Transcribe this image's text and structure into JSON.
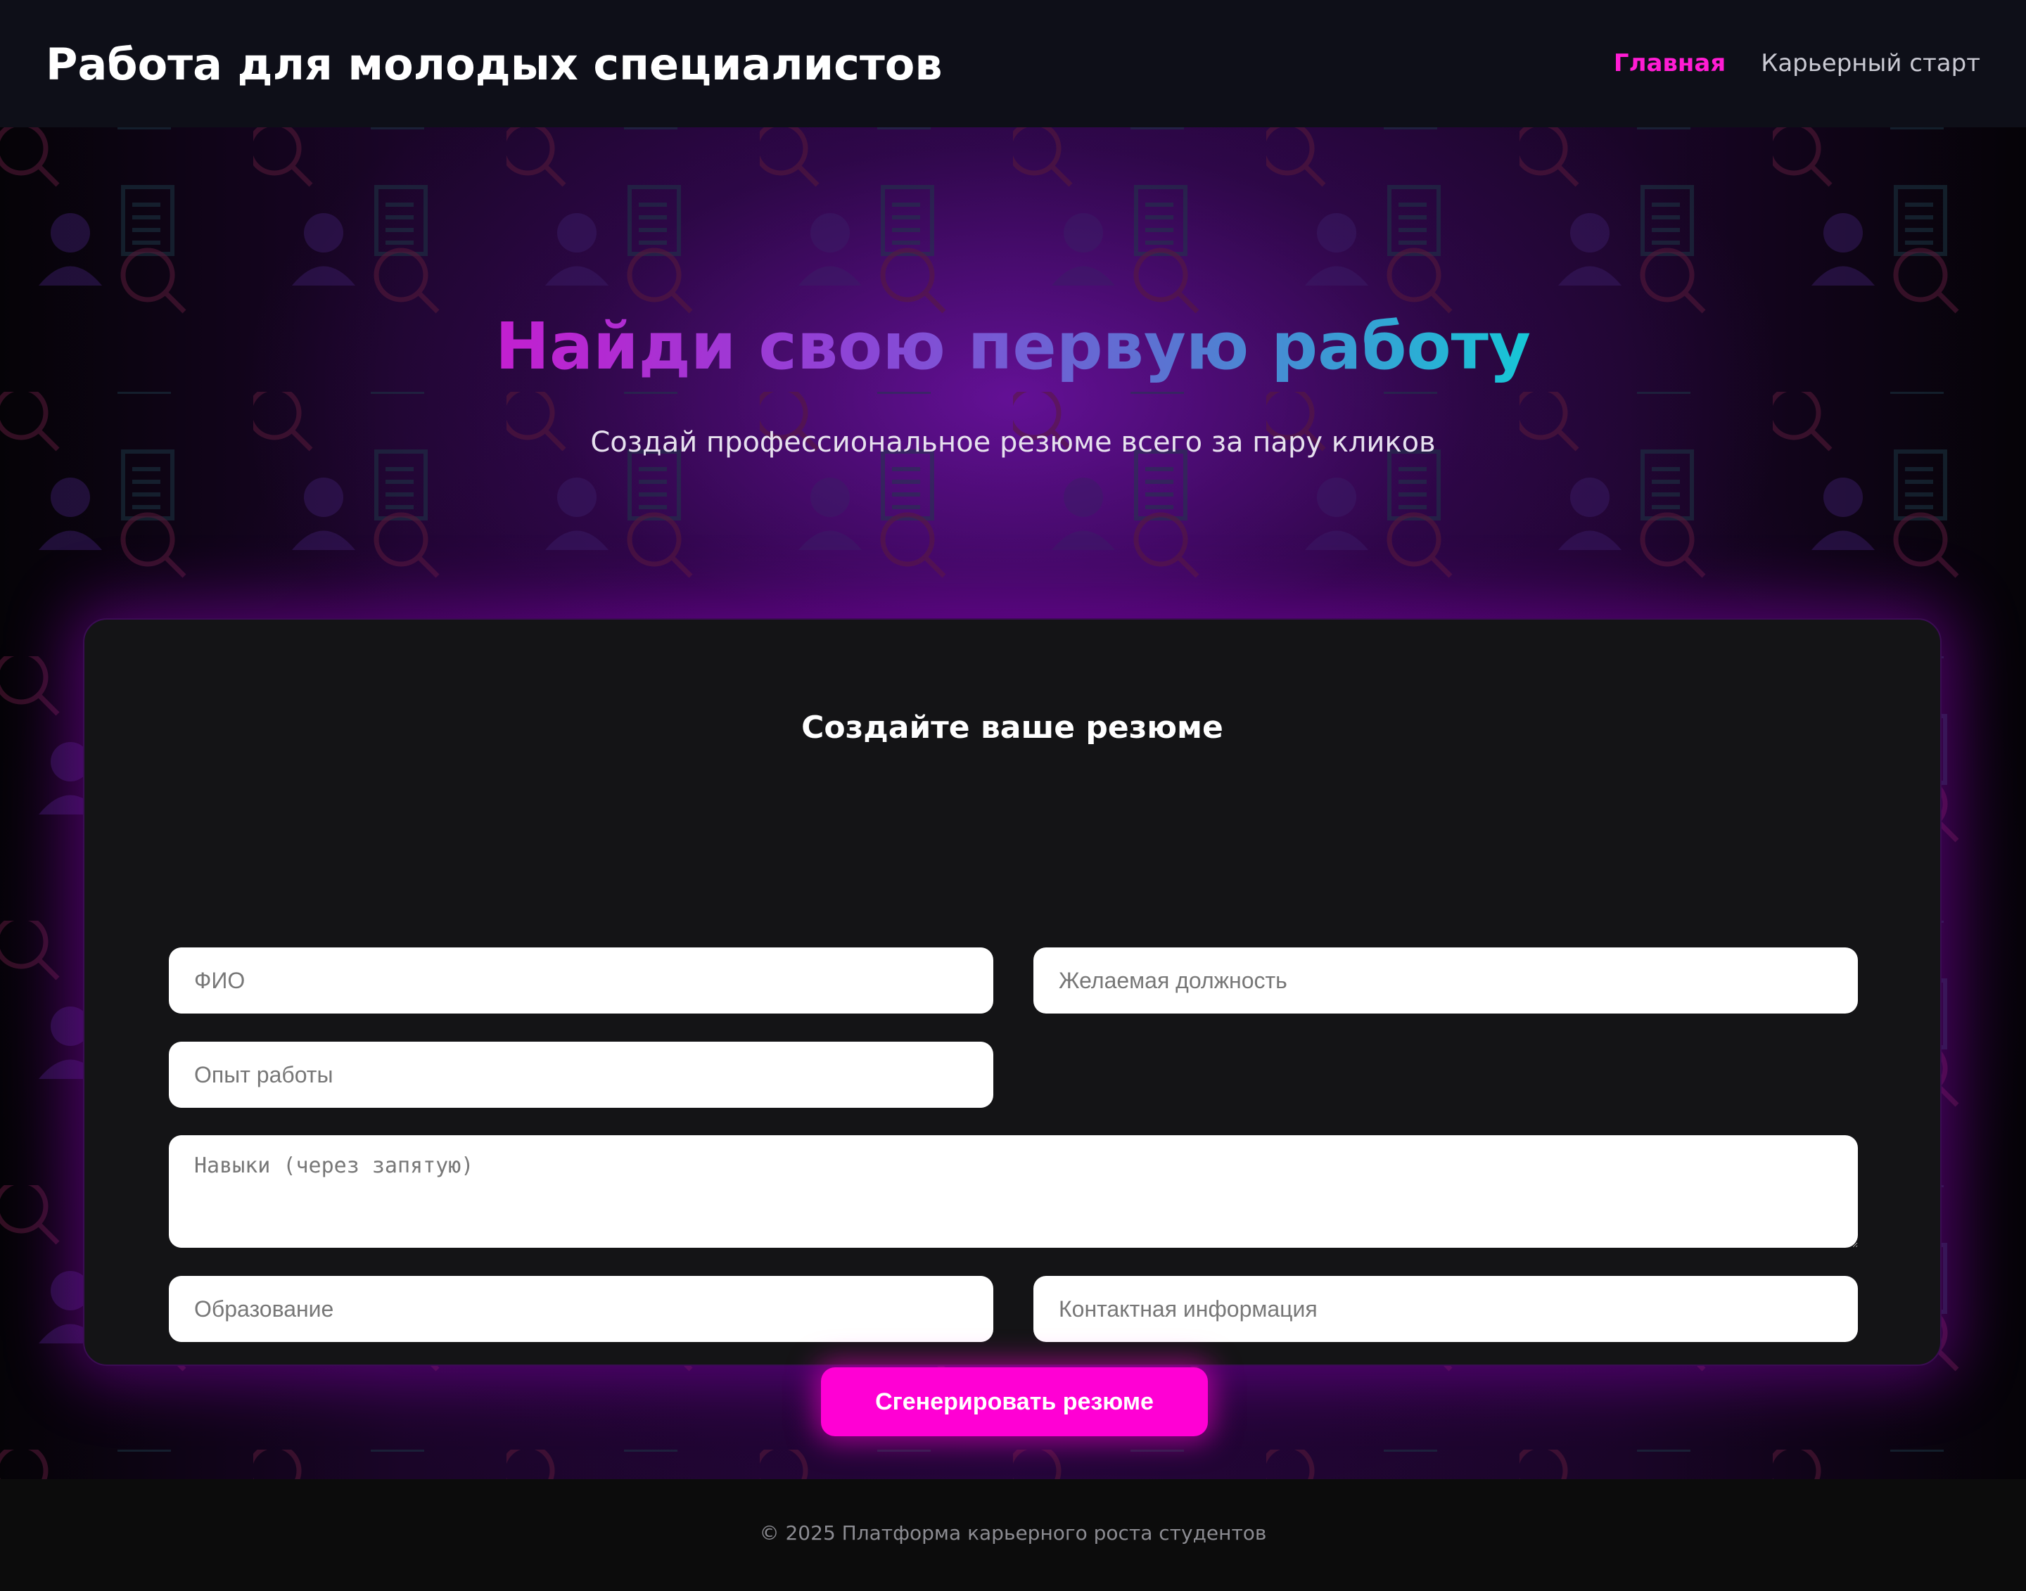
{
  "header": {
    "brand": "Работа для молодых специалистов",
    "nav": [
      {
        "label": "Главная",
        "active": true
      },
      {
        "label": "Карьерный старт",
        "active": false
      }
    ]
  },
  "hero": {
    "title": "Найди свою первую работу",
    "subtitle": "Создай профессиональное резюме всего за пару кликов"
  },
  "form": {
    "title": "Создайте ваше резюме",
    "fields": {
      "name": {
        "placeholder": "ФИО",
        "value": ""
      },
      "position": {
        "placeholder": "Желаемая должность",
        "value": ""
      },
      "experience": {
        "placeholder": "Опыт работы",
        "value": ""
      },
      "skills": {
        "placeholder": "Навыки (через запятую)",
        "value": ""
      },
      "education": {
        "placeholder": "Образование",
        "value": ""
      },
      "contacts": {
        "placeholder": "Контактная информация",
        "value": ""
      }
    },
    "submit_label": "Сгенерировать резюме"
  },
  "footer": {
    "text": "© 2025 Платформа карьерного роста студентов"
  },
  "colors": {
    "accent": "#ff00d4",
    "header_bg": "#0e0f18",
    "card_bg": "#141416"
  },
  "pattern_icons": [
    "document-icon",
    "user-icon",
    "magnifier-icon"
  ]
}
